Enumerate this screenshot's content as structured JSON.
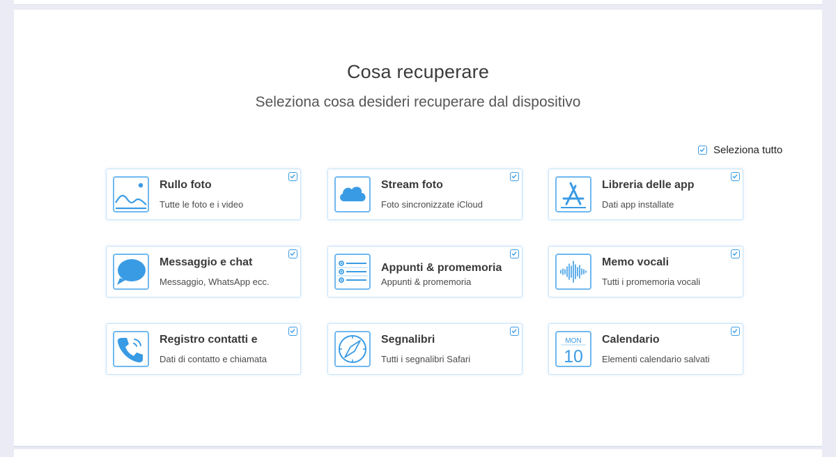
{
  "header": {
    "title": "Cosa recuperare",
    "subtitle": "Seleziona cosa desideri recuperare dal dispositivo"
  },
  "select_all": {
    "label": "Seleziona tutto",
    "checked": true
  },
  "theme": {
    "accent": "#3a9be5",
    "card_border": "#c6e3fa",
    "icon_border": "#6fb8f0"
  },
  "categories": [
    {
      "title": "Rullo foto",
      "description": "Tutte le foto e i video",
      "icon": "photo-gallery-icon",
      "checked": true
    },
    {
      "title": "Stream foto",
      "description": "Foto sincronizzate iCloud",
      "icon": "icloud-icon",
      "checked": true
    },
    {
      "title": "Libreria delle app",
      "description": "Dati app installate",
      "icon": "app-store-icon",
      "checked": true
    },
    {
      "title": "Messaggio e chat",
      "description": "Messaggio, WhatsApp ecc.",
      "icon": "chat-bubble-icon",
      "checked": true
    },
    {
      "title": "Appunti & promemoria",
      "description": "Appunti & promemoria",
      "icon": "notes-list-icon",
      "checked": true
    },
    {
      "title": "Memo vocali",
      "description": "Tutti i promemoria vocali",
      "icon": "voice-wave-icon",
      "checked": true
    },
    {
      "title": "Registro contatti e",
      "description": "Dati di contatto e chiamata",
      "icon": "phone-call-icon",
      "checked": true
    },
    {
      "title": "Segnalibri",
      "description": "Tutti i segnalibri Safari",
      "icon": "safari-compass-icon",
      "checked": true
    },
    {
      "title": "Calendario",
      "description": "Elementi calendario salvati",
      "icon": "calendar-icon",
      "checked": true,
      "icon_text": {
        "month": "MON",
        "day": "10"
      }
    }
  ]
}
